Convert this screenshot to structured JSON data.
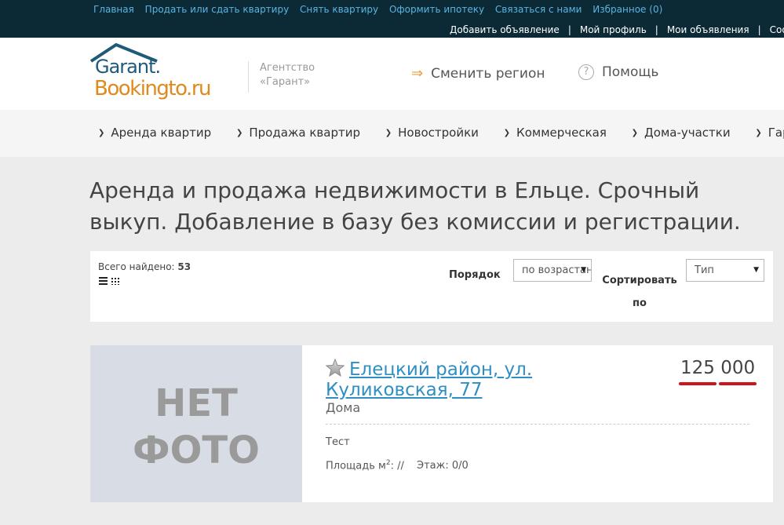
{
  "topnav": {
    "links": [
      "Главная",
      "Продать или сдать квартиру",
      "Снять квартиру",
      "Оформить ипотеку",
      "Связаться с нами",
      "Избранное (0)"
    ],
    "user_links": [
      "Добавить объявление",
      "Мой профиль",
      "Мои объявления",
      "Сообщения"
    ]
  },
  "header": {
    "logo_line1": "Garant.",
    "logo_line2": "Bookingto.ru",
    "agency_line1": "Агентство",
    "agency_line2": "«Гарант»",
    "region_label": "Сменить регион",
    "help_label": "Помощь",
    "help_glyph": "?",
    "arrow_glyph": "⇒"
  },
  "nav": {
    "items": [
      "Аренда квартир",
      "Продажа квартир",
      "Новостройки",
      "Коммерческая",
      "Дома-участки",
      "Гаражи"
    ]
  },
  "headline": "Аренда и продажа недвижимости в Ельце. Срочный выкуп. Добавление в базу без комиссии и регистрации.",
  "filter": {
    "found_label": "Всего найдено:",
    "found_count": "53",
    "order_label": "Порядок",
    "order_value": "по возрастанию",
    "sort_label": "Сортировать по",
    "sort_value": "Тип"
  },
  "listing": {
    "no_photo_line1": "НЕТ",
    "no_photo_line2": "ФОТО",
    "title": "Елецкий район, ул. Куликовская, 77",
    "type": "Дома",
    "price_part1": "125",
    "price_part2": "000",
    "description": "Тест",
    "area_label": "Площадь м",
    "area_sup": "2",
    "area_value": ": //",
    "floor": "Этаж: 0/0"
  },
  "colors": {
    "topbar_bg": "#0b2a36",
    "link_blue": "#2f8fc4",
    "logo_blue": "#1e5a7a",
    "logo_orange": "#e08a1e",
    "underline_red": "#d0121a"
  }
}
